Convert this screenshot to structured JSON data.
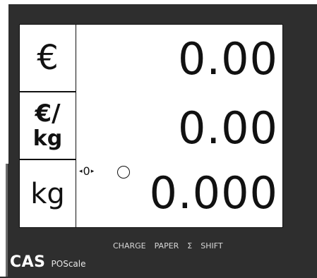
{
  "display": {
    "units": {
      "price": "€",
      "unit_price_symbol": "€/",
      "unit_price_unit": "kg",
      "weight": "kg"
    },
    "values": {
      "price": "0.00",
      "unit_price": "0.00",
      "weight": "0.000"
    },
    "zero_indicator": {
      "left": "◂",
      "digit": "0",
      "right": "▸"
    }
  },
  "indicators": [
    "CHARGE",
    "PAPER",
    "Σ",
    "SHIFT"
  ],
  "brand": {
    "name": "CAS",
    "model": "POScale"
  },
  "colors": {
    "body": "#2e2e2e",
    "screen": "#ffffff",
    "text": "#111111"
  }
}
